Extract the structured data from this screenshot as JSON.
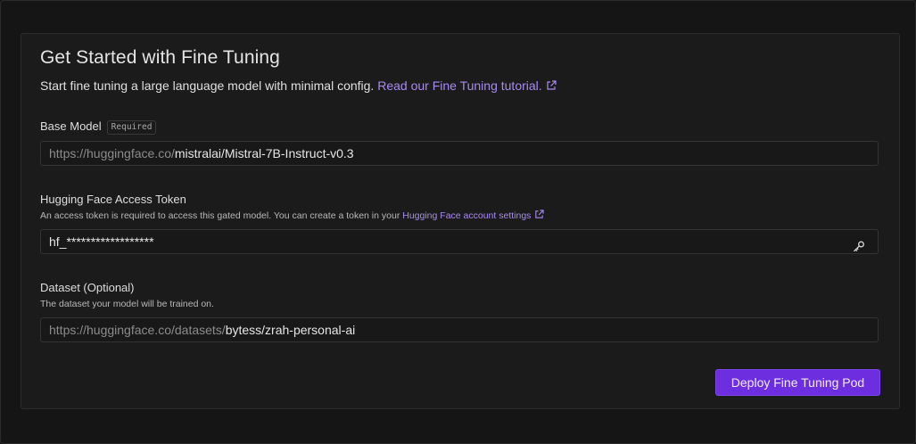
{
  "header": {
    "title": "Get Started with Fine Tuning",
    "subtitle": "Start fine tuning a large language model with minimal config.",
    "tutorial_link": "Read our Fine Tuning tutorial."
  },
  "base_model": {
    "label": "Base Model",
    "badge": "Required",
    "prefix": "https://huggingface.co/",
    "value": "mistralai/Mistral-7B-Instruct-v0.3"
  },
  "token": {
    "label": "Hugging Face Access Token",
    "hint": "An access token is required to access this gated model. You can create a token in your",
    "hint_link": "Hugging Face account settings",
    "value": "hf_******************",
    "icon": "key-icon"
  },
  "dataset": {
    "label": "Dataset (Optional)",
    "hint": "The dataset your model will be trained on.",
    "prefix": "https://huggingface.co/datasets/",
    "value": "bytess/zrah-personal-ai"
  },
  "actions": {
    "deploy_label": "Deploy Fine Tuning Pod"
  },
  "colors": {
    "accent": "#6d2ee0",
    "link": "#a98bf0",
    "background": "#141414",
    "card": "#1b1b1b"
  }
}
